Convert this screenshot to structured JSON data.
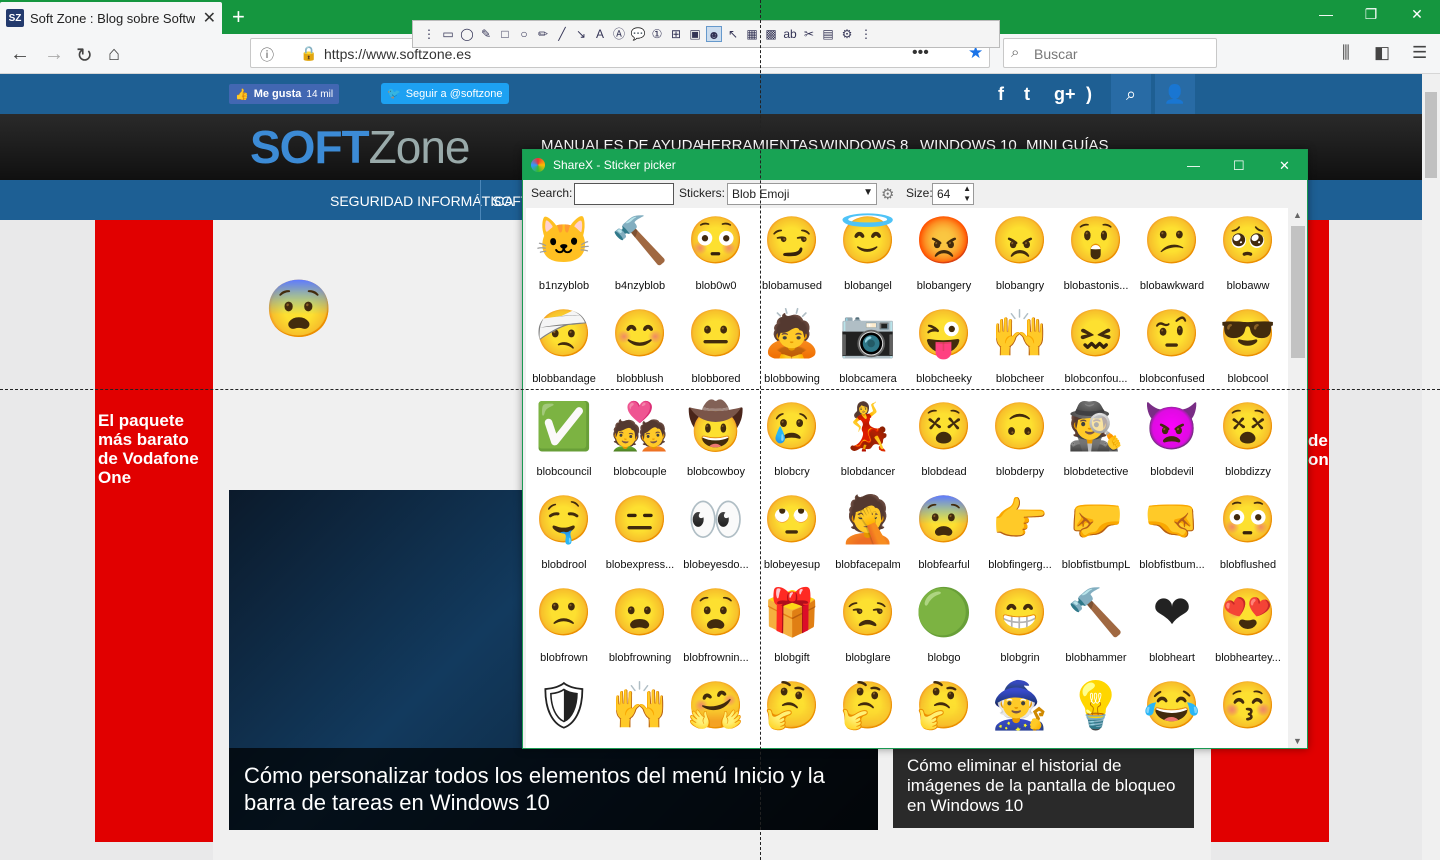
{
  "browser": {
    "tab_title": "Soft Zone : Blog sobre Software",
    "tab_favicon": "SZ",
    "url": "https://www.softzone.es",
    "search_placeholder": "Buscar"
  },
  "site": {
    "like_label": "Me gusta",
    "like_count": "14 mil",
    "twitter_label": "Seguir a @softzone",
    "logo_a": "SOFT",
    "logo_b": "Zone",
    "top_menu": [
      "MANUALES DE AYUDA",
      "HERRAMIENTAS",
      "WINDOWS 8",
      "WINDOWS 10",
      "MINI GUÍAS"
    ],
    "menu": [
      "SEGURIDAD INFORMÁTICA",
      "SOFTW"
    ],
    "ad_left": "El paquete más barato de Vodafone One",
    "ad_right": "de one",
    "article1": "Cómo personalizar todos los elementos del menú Inicio y la barra de tareas en Windows 10",
    "article2": "Cómo eliminar el historial de imágenes de la pantalla de bloqueo en Windows 10",
    "colors": {
      "blue_bar": "#1e5f93",
      "ad_red": "#e10000",
      "chrome_green": "#15963f"
    }
  },
  "sharex": {
    "title": "ShareX - Sticker picker",
    "search_label": "Search:",
    "search_value": "",
    "stickers_label": "Stickers:",
    "stickers_value": "Blob Emoji",
    "size_label": "Size:",
    "size_value": "64",
    "stickers": [
      {
        "name": "b1nzyblob",
        "glyph": "🐱"
      },
      {
        "name": "b4nzyblob",
        "glyph": "🔨"
      },
      {
        "name": "blob0w0",
        "glyph": "😳"
      },
      {
        "name": "blobamused",
        "glyph": "😏"
      },
      {
        "name": "blobangel",
        "glyph": "😇"
      },
      {
        "name": "blobangery",
        "glyph": "😡"
      },
      {
        "name": "blobangry",
        "glyph": "😠"
      },
      {
        "name": "blobastonis...",
        "glyph": "😲"
      },
      {
        "name": "blobawkward",
        "glyph": "😕"
      },
      {
        "name": "blobaww",
        "glyph": "🥺"
      },
      {
        "name": "blobbandage",
        "glyph": "🤕"
      },
      {
        "name": "blobblush",
        "glyph": "😊"
      },
      {
        "name": "blobbored",
        "glyph": "😐"
      },
      {
        "name": "blobbowing",
        "glyph": "🙇"
      },
      {
        "name": "blobcamera",
        "glyph": "📷"
      },
      {
        "name": "blobcheeky",
        "glyph": "😜"
      },
      {
        "name": "blobcheer",
        "glyph": "🙌"
      },
      {
        "name": "blobconfou...",
        "glyph": "😖"
      },
      {
        "name": "blobconfused",
        "glyph": "🤨"
      },
      {
        "name": "blobcool",
        "glyph": "😎"
      },
      {
        "name": "blobcouncil",
        "glyph": "✅"
      },
      {
        "name": "blobcouple",
        "glyph": "💑"
      },
      {
        "name": "blobcowboy",
        "glyph": "🤠"
      },
      {
        "name": "blobcry",
        "glyph": "😢"
      },
      {
        "name": "blobdancer",
        "glyph": "💃"
      },
      {
        "name": "blobdead",
        "glyph": "😵"
      },
      {
        "name": "blobderpy",
        "glyph": "🙃"
      },
      {
        "name": "blobdetective",
        "glyph": "🕵"
      },
      {
        "name": "blobdevil",
        "glyph": "👿"
      },
      {
        "name": "blobdizzy",
        "glyph": "😵"
      },
      {
        "name": "blobdrool",
        "glyph": "🤤"
      },
      {
        "name": "blobexpress...",
        "glyph": "😑"
      },
      {
        "name": "blobeyesdo...",
        "glyph": "👀"
      },
      {
        "name": "blobeyesup",
        "glyph": "🙄"
      },
      {
        "name": "blobfacepalm",
        "glyph": "🤦"
      },
      {
        "name": "blobfearful",
        "glyph": "😨"
      },
      {
        "name": "blobfingerg...",
        "glyph": "👉"
      },
      {
        "name": "blobfistbumpL",
        "glyph": "🤛"
      },
      {
        "name": "blobfistbum...",
        "glyph": "🤜"
      },
      {
        "name": "blobflushed",
        "glyph": "😳"
      },
      {
        "name": "blobfrown",
        "glyph": "🙁"
      },
      {
        "name": "blobfrowning",
        "glyph": "😦"
      },
      {
        "name": "blobfrownin...",
        "glyph": "😧"
      },
      {
        "name": "blobgift",
        "glyph": "🎁"
      },
      {
        "name": "blobglare",
        "glyph": "😒"
      },
      {
        "name": "blobgo",
        "glyph": "🟢"
      },
      {
        "name": "blobgrin",
        "glyph": "😁"
      },
      {
        "name": "blobhammer",
        "glyph": "🔨"
      },
      {
        "name": "blobheart",
        "glyph": "❤"
      },
      {
        "name": "blobheartey...",
        "glyph": "😍"
      },
      {
        "name": "",
        "glyph": "🛡"
      },
      {
        "name": "",
        "glyph": "🙌"
      },
      {
        "name": "",
        "glyph": "🤗"
      },
      {
        "name": "",
        "glyph": "🤔"
      },
      {
        "name": "",
        "glyph": "🤔"
      },
      {
        "name": "",
        "glyph": "🤔"
      },
      {
        "name": "",
        "glyph": "🧙"
      },
      {
        "name": "",
        "glyph": "💡"
      },
      {
        "name": "",
        "glyph": "😂"
      },
      {
        "name": "",
        "glyph": "😚"
      }
    ]
  }
}
